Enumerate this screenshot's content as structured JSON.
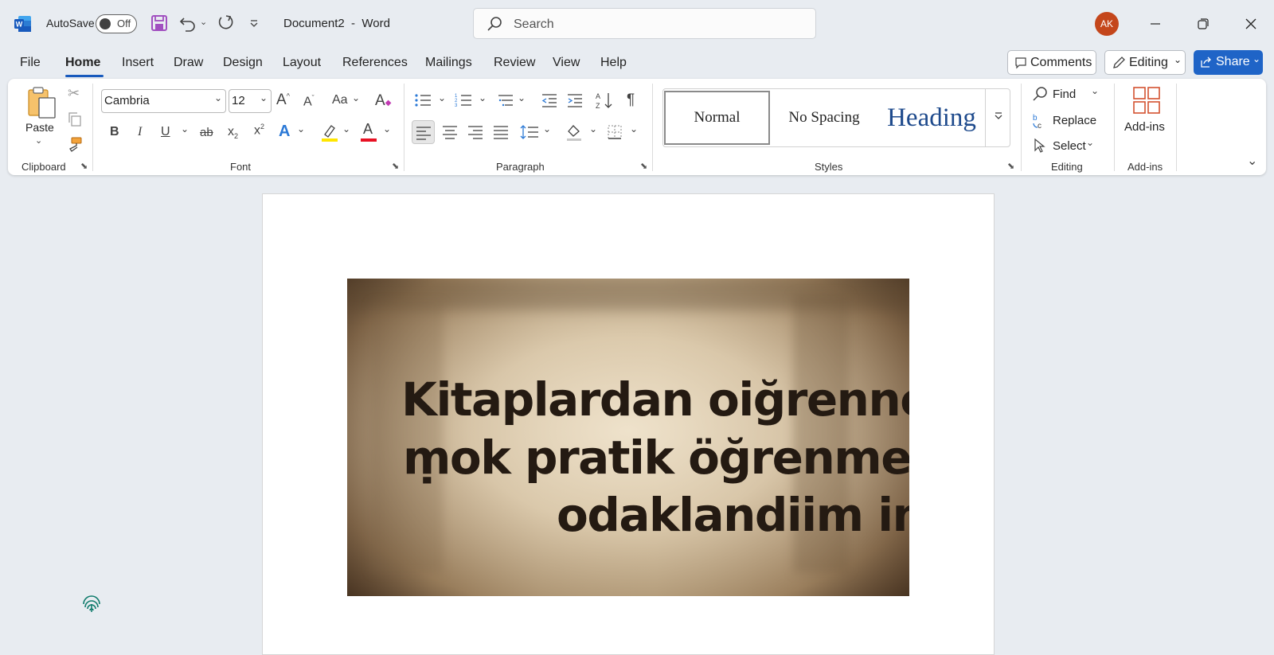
{
  "titlebar": {
    "autosave_label": "AutoSave",
    "autosave_state": "Off",
    "document_title": "Document2  -  Word",
    "search_placeholder": "Search",
    "user_initials": "AK"
  },
  "menu": {
    "tabs": [
      "File",
      "Home",
      "Insert",
      "Draw",
      "Design",
      "Layout",
      "References",
      "Mailings",
      "Review",
      "View",
      "Help"
    ],
    "active_tab": "Home",
    "comments_label": "Comments",
    "editing_label": "Editing",
    "share_label": "Share"
  },
  "ribbon": {
    "clipboard": {
      "paste_label": "Paste",
      "group_label": "Clipboard"
    },
    "font": {
      "font_name": "Cambria",
      "font_size": "12",
      "change_case": "Aa",
      "group_label": "Font"
    },
    "paragraph": {
      "group_label": "Paragraph"
    },
    "styles": {
      "normal": "Normal",
      "no_spacing": "No Spacing",
      "heading": "Heading",
      "group_label": "Styles"
    },
    "editing": {
      "find": "Find",
      "replace": "Replace",
      "select": "Select",
      "group_label": "Editing"
    },
    "addins": {
      "label": "Add-ins",
      "group_label": "Add-ins"
    }
  },
  "document": {
    "image_text": [
      "Kitaplardan oiğrennekten",
      "ṃok pratik öğrenmeye",
      "odaklandiim im."
    ]
  },
  "colors": {
    "accent": "#185abd",
    "share_bg": "#1f64c7",
    "avatar_bg": "#c4461b",
    "heading_style": "#1e4a8c",
    "highlight": "#ffe600",
    "font_color": "#e81123"
  }
}
